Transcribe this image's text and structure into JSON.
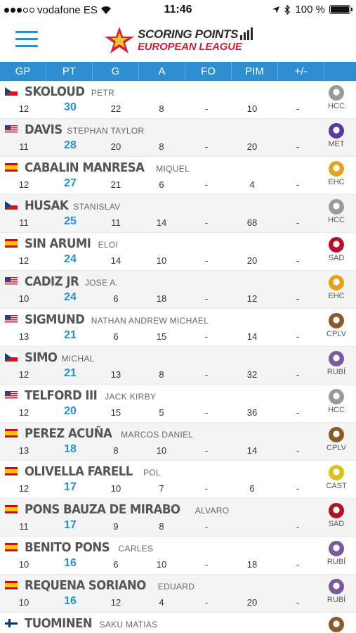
{
  "status": {
    "carrier": "vodafone ES",
    "time": "11:46",
    "battery": "100 %"
  },
  "header": {
    "logo_line1": "SCORING POINTS",
    "logo_line2": "EUROPEAN LEAGUE"
  },
  "columns": [
    "GP",
    "PT",
    "G",
    "A",
    "FO",
    "PIM",
    "+/-"
  ],
  "players": [
    {
      "last": "SKOLOUD",
      "first": "PETR",
      "country": "cz",
      "gp": "12",
      "pt": "30",
      "g": "22",
      "a": "8",
      "fo": "-",
      "pim": "10",
      "pm": "-",
      "team": "HCC"
    },
    {
      "last": "DAVIS",
      "first": "STEPHAN TAYLOR",
      "country": "us",
      "gp": "11",
      "pt": "28",
      "g": "20",
      "a": "8",
      "fo": "-",
      "pim": "20",
      "pm": "-",
      "team": "MET"
    },
    {
      "last": "CABALIN MANRESA",
      "first": "MIQUEL",
      "country": "es",
      "gp": "12",
      "pt": "27",
      "g": "21",
      "a": "6",
      "fo": "-",
      "pim": "4",
      "pm": "-",
      "team": "EHC"
    },
    {
      "last": "HUSAK",
      "first": "STANISLAV",
      "country": "cz",
      "gp": "11",
      "pt": "25",
      "g": "11",
      "a": "14",
      "fo": "-",
      "pim": "68",
      "pm": "-",
      "team": "HCC"
    },
    {
      "last": "SIN ARUMI",
      "first": "ELOI",
      "country": "es",
      "gp": "12",
      "pt": "24",
      "g": "14",
      "a": "10",
      "fo": "-",
      "pim": "20",
      "pm": "-",
      "team": "SAD"
    },
    {
      "last": "CADIZ JR",
      "first": "JOSE A.",
      "country": "us",
      "gp": "10",
      "pt": "24",
      "g": "6",
      "a": "18",
      "fo": "-",
      "pim": "12",
      "pm": "-",
      "team": "EHC"
    },
    {
      "last": "SIGMUND",
      "first": "NATHAN ANDREW MICHAEL",
      "country": "us",
      "gp": "13",
      "pt": "21",
      "g": "6",
      "a": "15",
      "fo": "-",
      "pim": "14",
      "pm": "-",
      "team": "CPLV"
    },
    {
      "last": "SIMO",
      "first": "MICHAL",
      "country": "cz",
      "gp": "12",
      "pt": "21",
      "g": "13",
      "a": "8",
      "fo": "-",
      "pim": "32",
      "pm": "-",
      "team": "RUBÍ"
    },
    {
      "last": "TELFORD III",
      "first": "JACK KIRBY",
      "country": "us",
      "gp": "12",
      "pt": "20",
      "g": "15",
      "a": "5",
      "fo": "-",
      "pim": "36",
      "pm": "-",
      "team": "HCC"
    },
    {
      "last": "PEREZ ACUÑA",
      "first": "MARCOS DANIEL",
      "country": "es",
      "gp": "13",
      "pt": "18",
      "g": "8",
      "a": "10",
      "fo": "-",
      "pim": "14",
      "pm": "-",
      "team": "CPLV"
    },
    {
      "last": "OLIVELLA FARELL",
      "first": "POL",
      "country": "es",
      "gp": "12",
      "pt": "17",
      "g": "10",
      "a": "7",
      "fo": "-",
      "pim": "6",
      "pm": "-",
      "team": "CAST"
    },
    {
      "last": "PONS BAUZA DE MIRABO",
      "first": "ALVARO",
      "country": "es",
      "gp": "11",
      "pt": "17",
      "g": "9",
      "a": "8",
      "fo": "-",
      "pim": "",
      "pm": "-",
      "team": "SAD"
    },
    {
      "last": "BENITO PONS",
      "first": "CARLES",
      "country": "es",
      "gp": "10",
      "pt": "16",
      "g": "6",
      "a": "10",
      "fo": "-",
      "pim": "18",
      "pm": "-",
      "team": "RUBÍ"
    },
    {
      "last": "REQUENA SORIANO",
      "first": "EDUARD",
      "country": "es",
      "gp": "10",
      "pt": "16",
      "g": "12",
      "a": "4",
      "fo": "-",
      "pim": "20",
      "pm": "-",
      "team": "RUBÍ"
    },
    {
      "last": "TUOMINEN",
      "first": "SAKU MATIAS",
      "country": "fi",
      "gp": "",
      "pt": "",
      "g": "",
      "a": "",
      "fo": "",
      "pim": "",
      "pm": "",
      "team": ""
    }
  ],
  "team_colors": {
    "HCC": "#9a9a9a",
    "MET": "#5b3a9b",
    "EHC": "#e4a21e",
    "SAD": "#b3122a",
    "CPLV": "#8a5a2a",
    "RUBÍ": "#7a5a9a",
    "CAST": "#d9c21a"
  }
}
